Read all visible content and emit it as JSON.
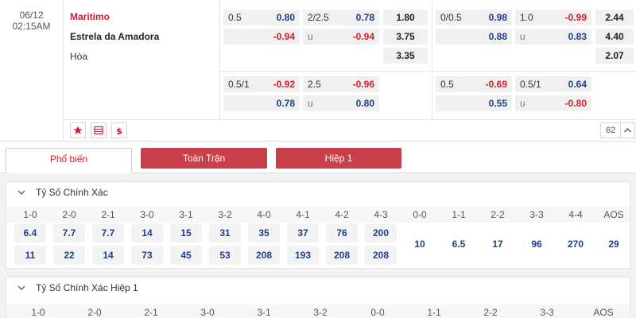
{
  "match": {
    "date": "06/12",
    "time": "02:15AM",
    "home": "Maritimo",
    "away": "Estrela da Amadora",
    "draw": "Hòa",
    "count": "62"
  },
  "odds": {
    "row1": {
      "ah_line": "0.5",
      "ah_home": "0.80",
      "ah_away": "-0.94",
      "ou_line": "2/2.5",
      "ou_over": "0.78",
      "ou_u": "u",
      "ou_under": "-0.94",
      "x12_home": "1.80",
      "x12_away": "3.75",
      "x12_draw": "3.35",
      "h1_ah_line": "0/0.5",
      "h1_ah_home": "0.98",
      "h1_ah_away": "0.88",
      "h1_ou_line": "1.0",
      "h1_ou_over": "-0.99",
      "h1_ou_u": "u",
      "h1_ou_under": "0.83",
      "h1_x12_home": "2.44",
      "h1_x12_away": "4.40",
      "h1_x12_draw": "2.07"
    },
    "row2": {
      "ah_line": "0.5/1",
      "ah_home": "-0.92",
      "ah_away": "0.78",
      "ou_line": "2.5",
      "ou_over": "-0.96",
      "ou_u": "u",
      "ou_under": "0.80",
      "h1_ah_line": "0.5",
      "h1_ah_home": "-0.69",
      "h1_ah_away": "0.55",
      "h1_ou_line": "0.5/1",
      "h1_ou_over": "0.64",
      "h1_ou_u": "u",
      "h1_ou_under": "-0.80"
    }
  },
  "tabs": [
    "Phổ biến",
    "Toàn Trận",
    "Hiệp 1"
  ],
  "correct_score": {
    "title": "Tỷ Số Chính Xác",
    "home_wins": [
      {
        "label": "1-0",
        "a": "6.4",
        "b": "11"
      },
      {
        "label": "2-0",
        "a": "7.7",
        "b": "22"
      },
      {
        "label": "2-1",
        "a": "7.7",
        "b": "14"
      },
      {
        "label": "3-0",
        "a": "14",
        "b": "73"
      },
      {
        "label": "3-1",
        "a": "15",
        "b": "45"
      },
      {
        "label": "3-2",
        "a": "31",
        "b": "53"
      },
      {
        "label": "4-0",
        "a": "35",
        "b": "208"
      },
      {
        "label": "4-1",
        "a": "37",
        "b": "193"
      },
      {
        "label": "4-2",
        "a": "76",
        "b": "208"
      },
      {
        "label": "4-3",
        "a": "200",
        "b": "208"
      }
    ],
    "draws": [
      {
        "label": "0-0",
        "v": "10"
      },
      {
        "label": "1-1",
        "v": "6.5"
      },
      {
        "label": "2-2",
        "v": "17"
      },
      {
        "label": "3-3",
        "v": "96"
      },
      {
        "label": "4-4",
        "v": "270"
      },
      {
        "label": "AOS",
        "v": "29"
      }
    ]
  },
  "correct_score_h1": {
    "title": "Tỷ Số Chính Xác Hiệp 1",
    "labels": [
      "1-0",
      "2-0",
      "2-1",
      "3-0",
      "3-1",
      "3-2",
      "0-0",
      "1-1",
      "2-2",
      "3-3",
      "AOS"
    ]
  }
}
